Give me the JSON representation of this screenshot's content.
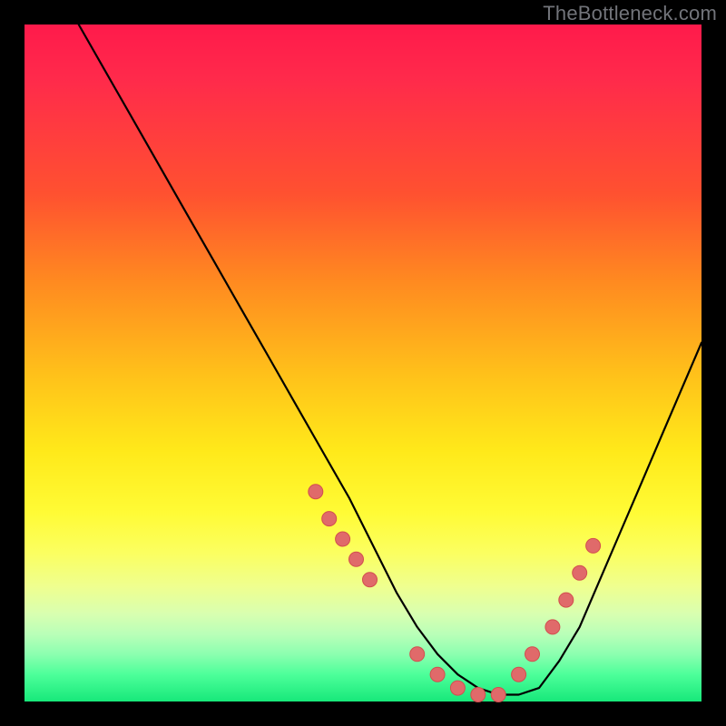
{
  "watermark": "TheBottleneck.com",
  "colors": {
    "curve_stroke": "#000000",
    "dot_fill": "#e06a6a",
    "dot_stroke": "#d24e4e"
  },
  "chart_data": {
    "type": "line",
    "title": "",
    "xlabel": "",
    "ylabel": "",
    "xlim": [
      0,
      100
    ],
    "ylim": [
      0,
      100
    ],
    "series": [
      {
        "name": "bottleneck-curve",
        "x": [
          8,
          12,
          16,
          20,
          24,
          28,
          32,
          36,
          40,
          44,
          48,
          52,
          55,
          58,
          61,
          64,
          67,
          70,
          73,
          76,
          79,
          82,
          85,
          88,
          91,
          94,
          97,
          100
        ],
        "y": [
          100,
          93,
          86,
          79,
          72,
          65,
          58,
          51,
          44,
          37,
          30,
          22,
          16,
          11,
          7,
          4,
          2,
          1,
          1,
          2,
          6,
          11,
          18,
          25,
          32,
          39,
          46,
          53
        ]
      }
    ],
    "dots": {
      "name": "highlighted-points",
      "x": [
        43,
        45,
        47,
        49,
        51,
        58,
        61,
        64,
        67,
        70,
        73,
        75,
        78,
        80,
        82,
        84
      ],
      "y": [
        31,
        27,
        24,
        21,
        18,
        7,
        4,
        2,
        1,
        1,
        4,
        7,
        11,
        15,
        19,
        23
      ]
    }
  }
}
